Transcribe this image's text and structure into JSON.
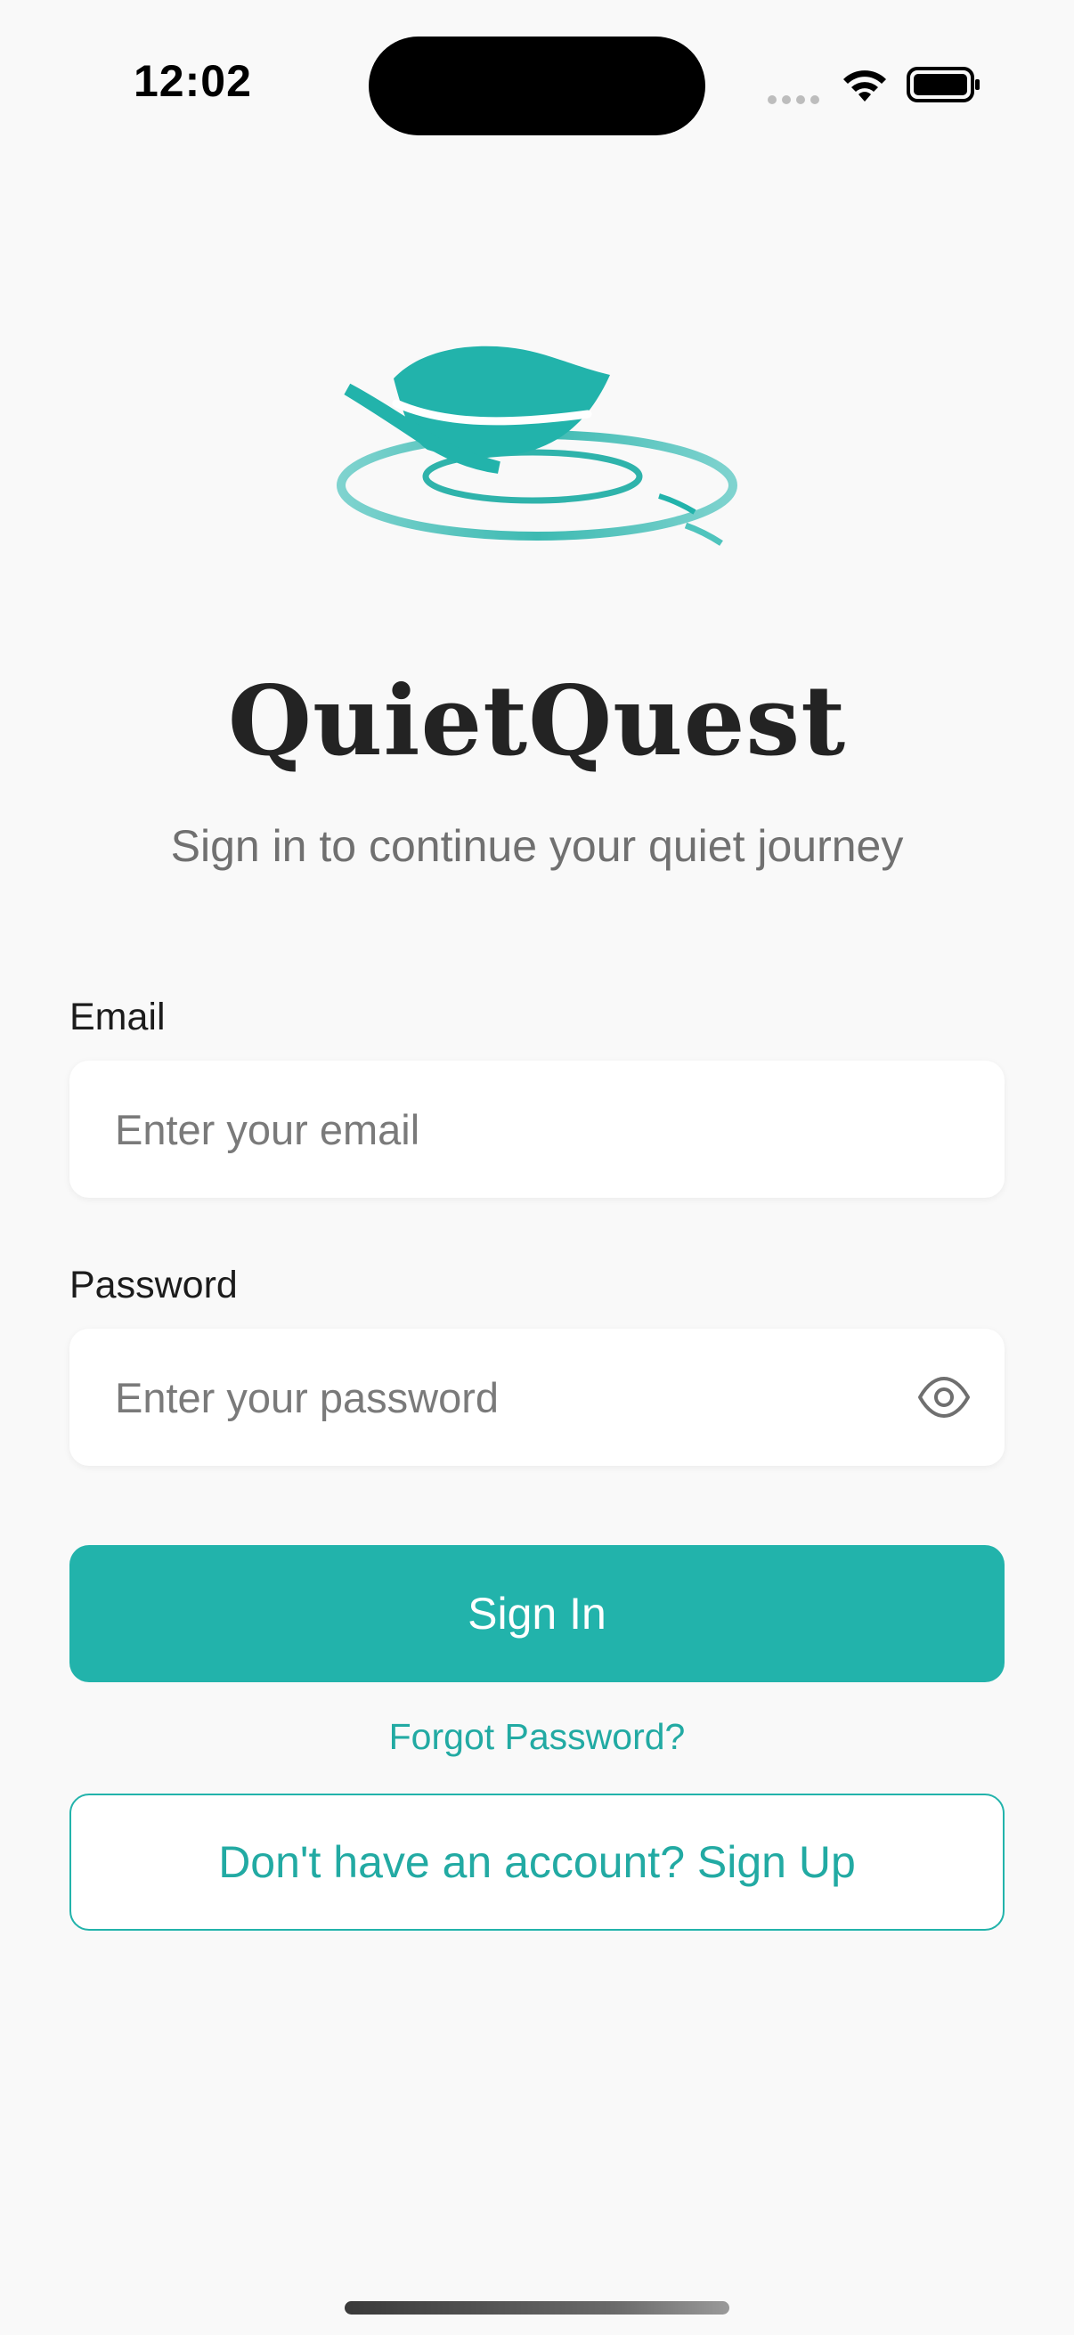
{
  "status_bar": {
    "time": "12:02"
  },
  "app": {
    "name": "QuietQuest",
    "subtitle": "Sign in to continue your quiet journey",
    "logo_icon": "leaf-ripple-logo"
  },
  "form": {
    "email_label": "Email",
    "email_value": "",
    "email_placeholder": "Enter your email",
    "password_label": "Password",
    "password_value": "",
    "password_placeholder": "Enter your password",
    "password_toggle_icon": "eye-icon",
    "signin_label": "Sign In",
    "forgot_label": "Forgot Password?",
    "signup_label": "Don't have an account? Sign Up"
  },
  "colors": {
    "accent": "#22b3ab",
    "background": "#f9f9f9",
    "title_text": "#232323",
    "subtitle_text": "#707070"
  }
}
